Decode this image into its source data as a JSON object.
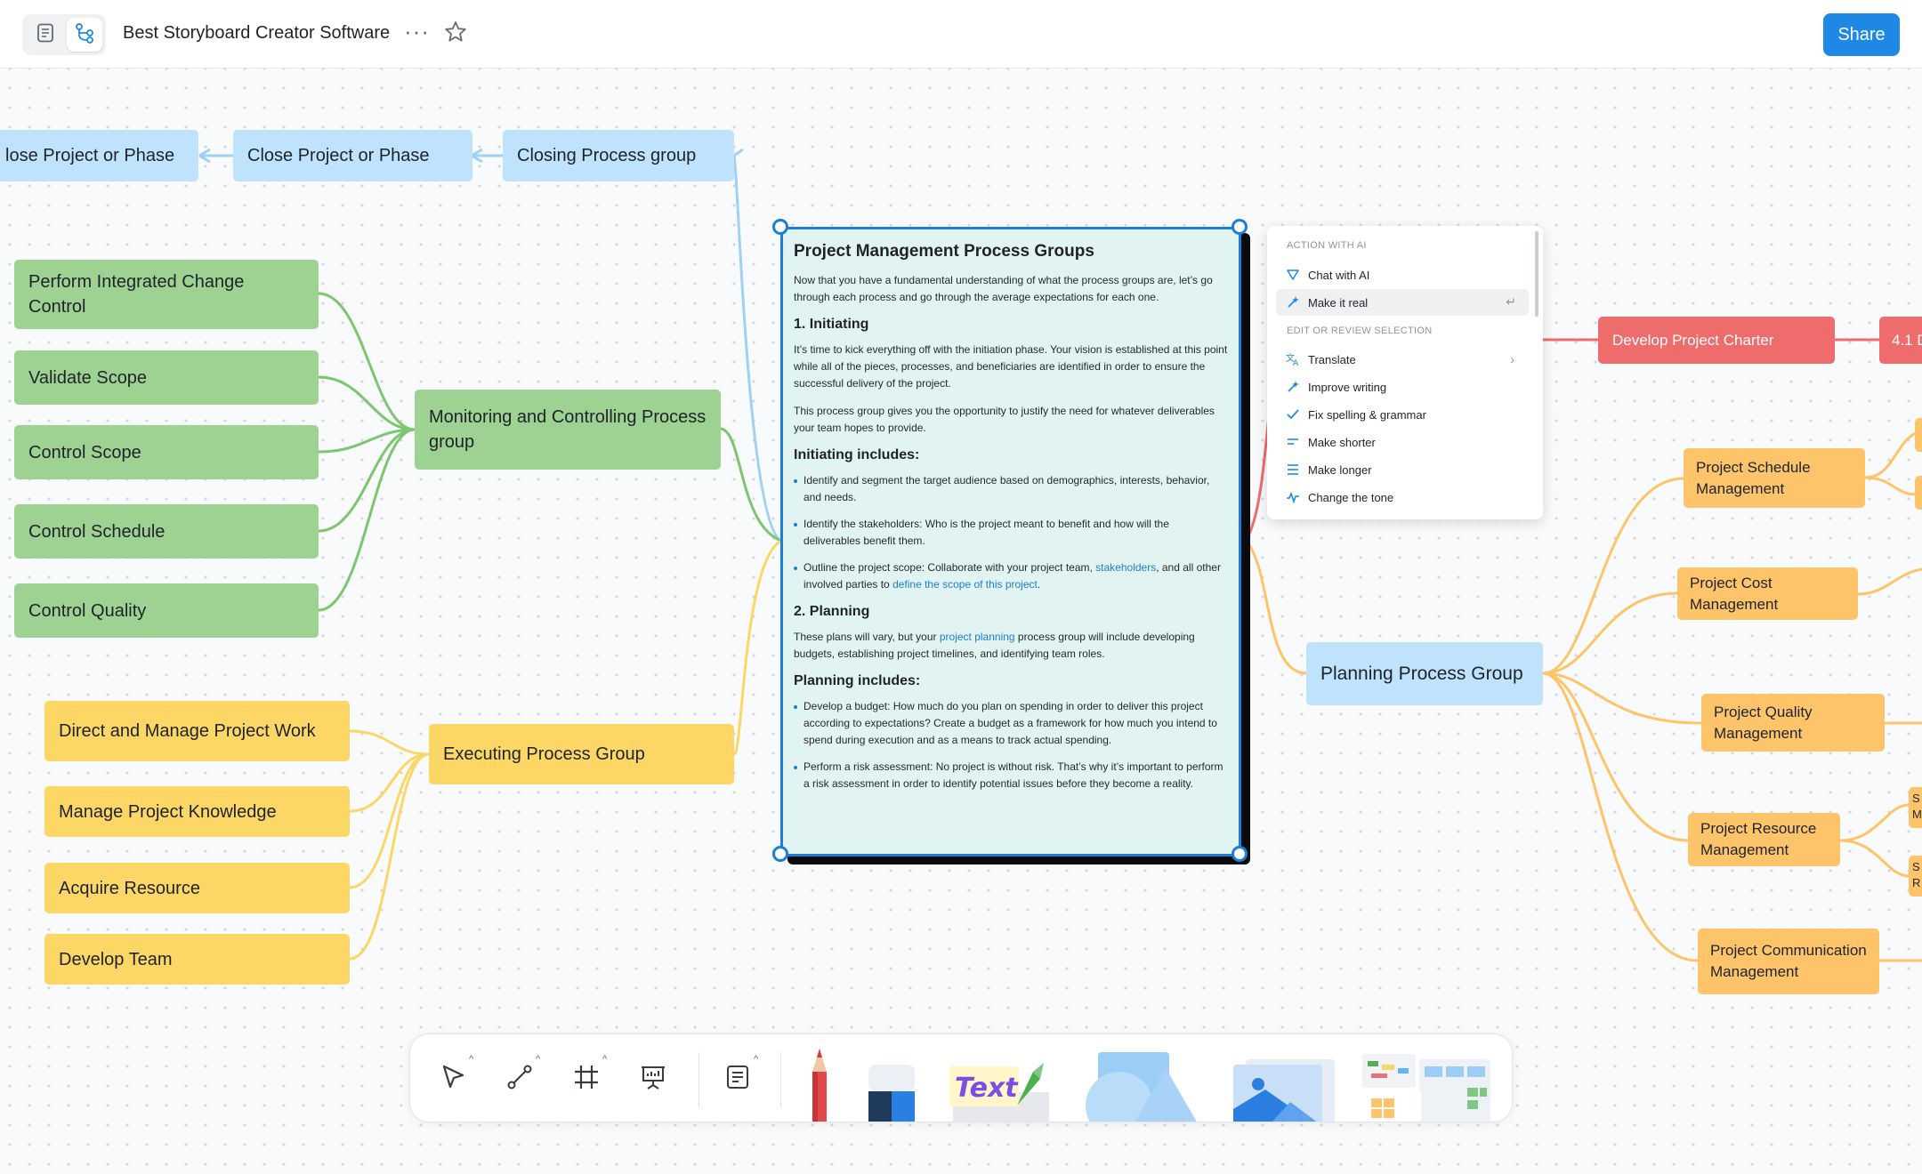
{
  "header": {
    "title": "Best Storyboard Creator Software",
    "more_label": "···",
    "share_label": "Share"
  },
  "nodes": {
    "close_project_1": "lose Project or Phase",
    "close_project_2": "Close Project or Phase",
    "closing_group": "Closing Process group",
    "perform_integrated": "Perform Integrated  Change Control",
    "validate_scope": "Validate Scope",
    "control_scope": "Control Scope",
    "control_schedule": "Control Schedule",
    "control_quality": "Control Quality",
    "monitoring_group": "Monitoring and Controlling Process group",
    "direct_manage": "Direct and Manage Project Work",
    "manage_knowledge": "Manage Project Knowledge",
    "acquire_resource": "Acquire Resource",
    "develop_team": "Develop Team",
    "executing_group": "Executing Process Group",
    "develop_charter": "Develop Project Charter",
    "charter_next": "4.1 D",
    "planning_group": "Planning Process Group",
    "schedule_mgmt": "Project Schedule Management",
    "cost_mgmt": "Project Cost Management",
    "quality_mgmt": "Project Quality Management",
    "resource_mgmt": "Project Resource Management",
    "communication_mgmt": "Project Communication Management",
    "edge_s1": "S",
    "edge_m1": "M",
    "edge_s2": "S",
    "edge_r2": "R"
  },
  "card": {
    "title": "Project Management Process Groups",
    "intro": "Now that you have a fundamental understanding of what the process groups are, let’s go through each process and go through the average expectations for each one.",
    "h_initiating": "1. Initiating",
    "p_initiating_1": "It’s time to kick everything off with the initiation phase. Your vision is established at this point while all of the pieces, processes, and beneficiaries are identified in order to ensure the successful delivery of the project.",
    "p_initiating_2": "This process group gives you the opportunity to justify the need for whatever deliverables your team hopes to provide.",
    "h_initiating_includes": "Initiating includes:",
    "init_items": [
      "Identify and segment the target audience based on demographics, interests, behavior, and needs.",
      "Identify the stakeholders: Who is the project meant to benefit and how will the deliverables benefit them."
    ],
    "init_item3_a": "Outline the project scope: Collaborate with your project team, ",
    "init_item3_link1": "stakeholders",
    "init_item3_b": ", and all other involved parties to ",
    "init_item3_link2": "define the scope of this project",
    "init_item3_c": ".",
    "h_planning": "2. Planning",
    "p_planning_a": "These plans will vary, but your ",
    "p_planning_link": "project planning",
    "p_planning_b": " process group will include developing budgets, establishing project timelines, and identifying team roles.",
    "h_planning_includes": "Planning includes:",
    "plan_items": [
      "Develop a budget: How much do you plan on spending in order to deliver this project according to expectations? Create a budget as a framework for how much you intend to spend during execution and as a means to track actual spending.",
      "Perform a risk assessment: No project is without risk. That’s why it’s important to perform a risk assessment in order to identify potential issues before they become a reality."
    ]
  },
  "ai_menu": {
    "section_action": "ACTION WITH AI",
    "chat_with_ai": "Chat with AI",
    "make_it_real": "Make it real",
    "section_edit": "EDIT OR REVIEW SELECTION",
    "translate": "Translate",
    "improve_writing": "Improve writing",
    "fix_spelling": "Fix spelling & grammar",
    "make_shorter": "Make shorter",
    "make_longer": "Make longer",
    "change_tone": "Change the tone"
  },
  "toolbar": {
    "caret": "^",
    "text_sticker": "Text"
  },
  "colors": {
    "accent": "#1e88e5",
    "blue_node": "#bfe2fd",
    "green_node": "#9dd292",
    "yellow_node": "#fdd766",
    "orange_node": "#fdc46a",
    "red_node": "#ee6c6c",
    "card_bg": "#e2f4f2"
  },
  "icons": [
    "document-icon",
    "mindmap-icon",
    "star-icon",
    "select-pointer-icon",
    "connector-icon",
    "frame-icon",
    "presentation-icon",
    "note-icon",
    "pencil-icon",
    "eraser-icon",
    "text-sticker-icon",
    "shapes-icon",
    "image-icon",
    "templates-icon",
    "sparkle-icon",
    "magic-wand-icon",
    "translate-icon",
    "check-icon",
    "shorter-icon",
    "longer-icon",
    "tone-icon",
    "enter-icon",
    "chevron-right-icon"
  ]
}
